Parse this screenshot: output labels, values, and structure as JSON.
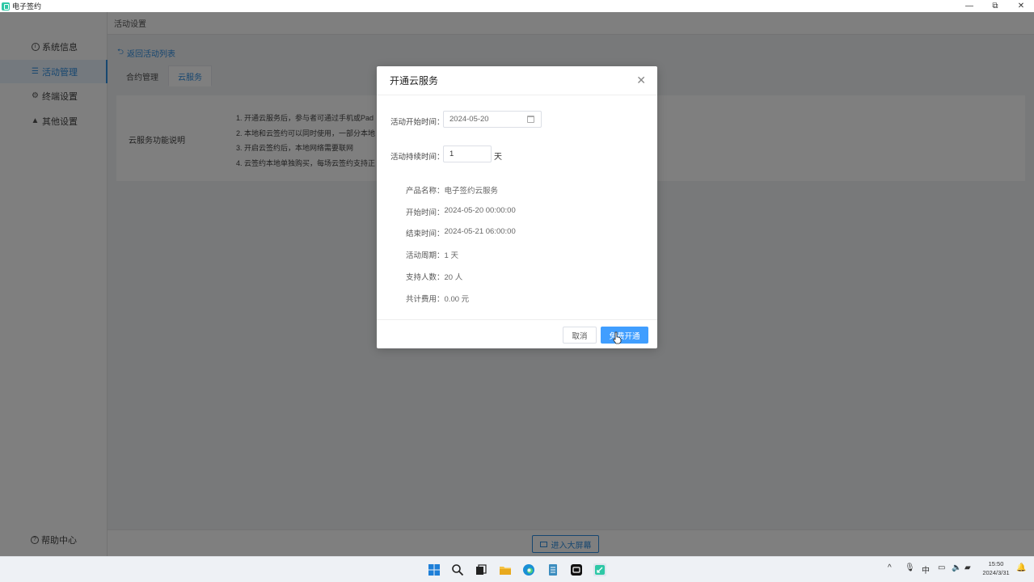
{
  "window": {
    "title": "电子签约",
    "min": "—",
    "max": "⧉",
    "close": "✕"
  },
  "sidebar": {
    "items": [
      {
        "label": "系统信息",
        "icon": "info-icon"
      },
      {
        "label": "活动管理",
        "icon": "list-icon"
      },
      {
        "label": "终端设置",
        "icon": "gear-icon"
      },
      {
        "label": "其他设置",
        "icon": "warning-icon"
      }
    ],
    "active_index": 1,
    "help": "帮助中心"
  },
  "header": {
    "title": "活动设置"
  },
  "back_link": "返回活动列表",
  "tabs": [
    {
      "label": "合约管理"
    },
    {
      "label": "云服务"
    }
  ],
  "active_tab": 1,
  "panel": {
    "label": "云服务功能说明",
    "lines": [
      "1. 开通云服务后，参与者可通过手机或Pad",
      "2. 本地和云签约可以同时使用，一部分本地",
      "3. 开启云签约后，本地网络需要联网",
      "4. 云签约本地单独购买，每场云签约支持正"
    ]
  },
  "bottom": {
    "big_screen_button": "进入大屏幕"
  },
  "dialog": {
    "title": "开通云服务",
    "start_label": "活动开始时间：",
    "start_value": "2024-05-20",
    "duration_label": "活动持续时间：",
    "duration_value": "1",
    "duration_unit": "天",
    "info": [
      {
        "k": "产品名称：",
        "v": "电子签约云服务"
      },
      {
        "k": "开始时间：",
        "v": "2024-05-20 00:00:00"
      },
      {
        "k": "结束时间：",
        "v": "2024-05-21 06:00:00"
      },
      {
        "k": "活动周期：",
        "v": "1 天"
      },
      {
        "k": "支持人数：",
        "v": "20 人"
      },
      {
        "k": "共计费用：",
        "v": "0.00 元"
      }
    ],
    "cancel": "取消",
    "confirm": "免费开通"
  },
  "taskbar": {
    "tray_ime": "中",
    "time": "15:50",
    "date": "2024/3/31"
  },
  "colors": {
    "accent": "#409eff",
    "link": "#2f8ee0",
    "app_icon": "#2ec8a6"
  }
}
